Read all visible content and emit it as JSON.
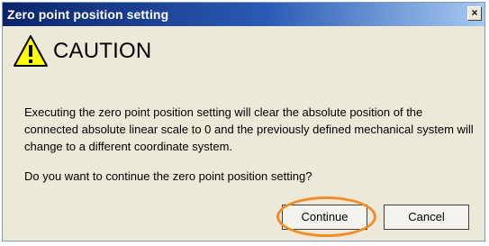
{
  "window": {
    "title": "Zero point position setting",
    "close_glyph": "×"
  },
  "icons": {
    "warning": "warning-triangle-icon",
    "close": "close-icon"
  },
  "colors": {
    "warning_yellow": "#ffff00",
    "title_blue": "#0a246a",
    "highlight_orange": "#f28c28"
  },
  "content": {
    "heading": "CAUTION",
    "message": "Executing the zero point position setting will clear the absolute position of the connected absolute linear scale to 0 and the previously defined mechanical system will change to a different coordinate system.",
    "question": "Do you want to continue the zero point position setting?"
  },
  "buttons": {
    "continue_label": "Continue",
    "cancel_label": "Cancel"
  }
}
